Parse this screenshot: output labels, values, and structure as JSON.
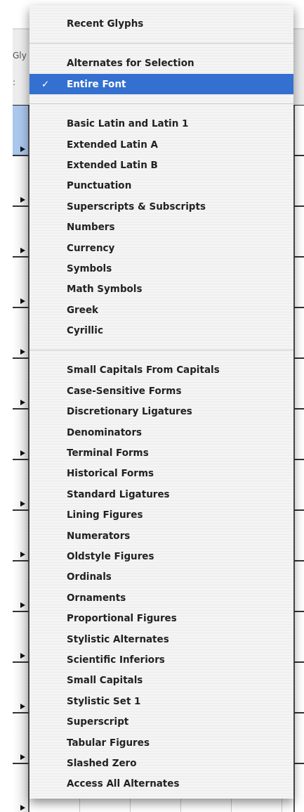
{
  "window": {
    "title_fragment": "Gly",
    "field_label_fragment": ":"
  },
  "glyph_grid": {
    "left_cells": [
      {
        "selected": true
      },
      {
        "selected": false
      },
      {
        "selected": false
      },
      {
        "selected": false
      },
      {
        "selected": false
      },
      {
        "selected": false
      },
      {
        "selected": false
      },
      {
        "selected": false
      },
      {
        "selected": false
      },
      {
        "selected": false
      },
      {
        "selected": false
      },
      {
        "selected": false
      },
      {
        "selected": false
      },
      {
        "selected": false
      }
    ]
  },
  "menu": {
    "check_mark": "✓",
    "groups": [
      {
        "items": [
          {
            "label": "Recent Glyphs",
            "checked": false,
            "selected": false
          }
        ]
      },
      {
        "items": [
          {
            "label": "Alternates for Selection",
            "checked": false,
            "selected": false
          },
          {
            "label": "Entire Font",
            "checked": true,
            "selected": true
          }
        ]
      },
      {
        "items": [
          {
            "label": "Basic Latin and Latin 1",
            "checked": false,
            "selected": false
          },
          {
            "label": "Extended Latin A",
            "checked": false,
            "selected": false
          },
          {
            "label": "Extended Latin B",
            "checked": false,
            "selected": false
          },
          {
            "label": "Punctuation",
            "checked": false,
            "selected": false
          },
          {
            "label": "Superscripts & Subscripts",
            "checked": false,
            "selected": false
          },
          {
            "label": "Numbers",
            "checked": false,
            "selected": false
          },
          {
            "label": "Currency",
            "checked": false,
            "selected": false
          },
          {
            "label": "Symbols",
            "checked": false,
            "selected": false
          },
          {
            "label": "Math Symbols",
            "checked": false,
            "selected": false
          },
          {
            "label": "Greek",
            "checked": false,
            "selected": false
          },
          {
            "label": "Cyrillic",
            "checked": false,
            "selected": false
          }
        ]
      },
      {
        "items": [
          {
            "label": "Small Capitals From Capitals",
            "checked": false,
            "selected": false
          },
          {
            "label": "Case-Sensitive Forms",
            "checked": false,
            "selected": false
          },
          {
            "label": "Discretionary Ligatures",
            "checked": false,
            "selected": false
          },
          {
            "label": "Denominators",
            "checked": false,
            "selected": false
          },
          {
            "label": "Terminal Forms",
            "checked": false,
            "selected": false
          },
          {
            "label": "Historical Forms",
            "checked": false,
            "selected": false
          },
          {
            "label": "Standard Ligatures",
            "checked": false,
            "selected": false
          },
          {
            "label": "Lining Figures",
            "checked": false,
            "selected": false
          },
          {
            "label": "Numerators",
            "checked": false,
            "selected": false
          },
          {
            "label": "Oldstyle Figures",
            "checked": false,
            "selected": false
          },
          {
            "label": "Ordinals",
            "checked": false,
            "selected": false
          },
          {
            "label": "Ornaments",
            "checked": false,
            "selected": false
          },
          {
            "label": "Proportional Figures",
            "checked": false,
            "selected": false
          },
          {
            "label": "Stylistic Alternates",
            "checked": false,
            "selected": false
          },
          {
            "label": "Scientific Inferiors",
            "checked": false,
            "selected": false
          },
          {
            "label": "Small Capitals",
            "checked": false,
            "selected": false
          },
          {
            "label": "Stylistic Set 1",
            "checked": false,
            "selected": false
          },
          {
            "label": "Superscript",
            "checked": false,
            "selected": false
          },
          {
            "label": "Tabular Figures",
            "checked": false,
            "selected": false
          },
          {
            "label": "Slashed Zero",
            "checked": false,
            "selected": false
          },
          {
            "label": "Access All Alternates",
            "checked": false,
            "selected": false
          }
        ]
      }
    ]
  }
}
